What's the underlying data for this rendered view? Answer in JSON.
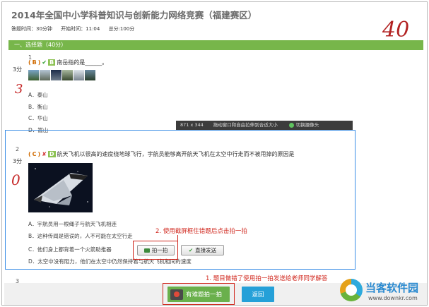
{
  "header": {
    "title": "2014年全国中小学科普知识与创新能力网络竞赛（福建赛区）",
    "answer_time": "答题时间：30分钟",
    "start_time": "开始时间：11:04",
    "total_score": "总分:100分",
    "score": "40"
  },
  "section": {
    "title": "一、选择题（40分）"
  },
  "questions": [
    {
      "number": "1",
      "points": "3分",
      "paren_open": "(",
      "user_answer": "B",
      "paren_close": ")",
      "correct_answer": "B",
      "text": "南岳指的是______。",
      "options": [
        "A．泰山",
        "B．衡山",
        "C．华山",
        "D．嵩山"
      ],
      "hand_score": "3"
    },
    {
      "number": "2",
      "points": "3分",
      "paren_open": "(",
      "user_answer": "C",
      "paren_close": ")",
      "correct_answer": "D",
      "text": "航天飞机以很高的速度绕地球飞行，宇航员能够离开航天飞机在太空中行走而不被甩掉的原因是",
      "options": [
        "A．宇航员用一根绳子与航天飞机相连",
        "B．这种传闻是错误的，人不可能在太空行走",
        "C．他们身上都背着一个火箭助推器",
        "D．太空中没有阻力，他们在太空中仍然保持着与航天飞机相同的速度"
      ],
      "hand_score": "0"
    },
    {
      "number": "3",
      "partial_text": "B"
    }
  ],
  "capture_toolbar": {
    "dimensions": "871 x 344",
    "hint": "拖动窗口和自由拉伸到合适大小",
    "switch_camera": "切换摄像头"
  },
  "capture_buttons": {
    "snap": "拍一拍",
    "send": "直接发送"
  },
  "annotations": {
    "step1": "1. 题目做错了使用拍一拍发送给老师同学解答",
    "step2": "2. 使用截屏框住错题后点击拍一拍"
  },
  "bottom": {
    "hard_question": "有难题拍一拍",
    "back": "返回"
  },
  "watermark": {
    "name": "当客软件园",
    "url": "www.downkr.com"
  },
  "colors": {
    "section_green": "#77b64a",
    "annotation_red": "#d0261c",
    "back_blue": "#25a0d8"
  }
}
